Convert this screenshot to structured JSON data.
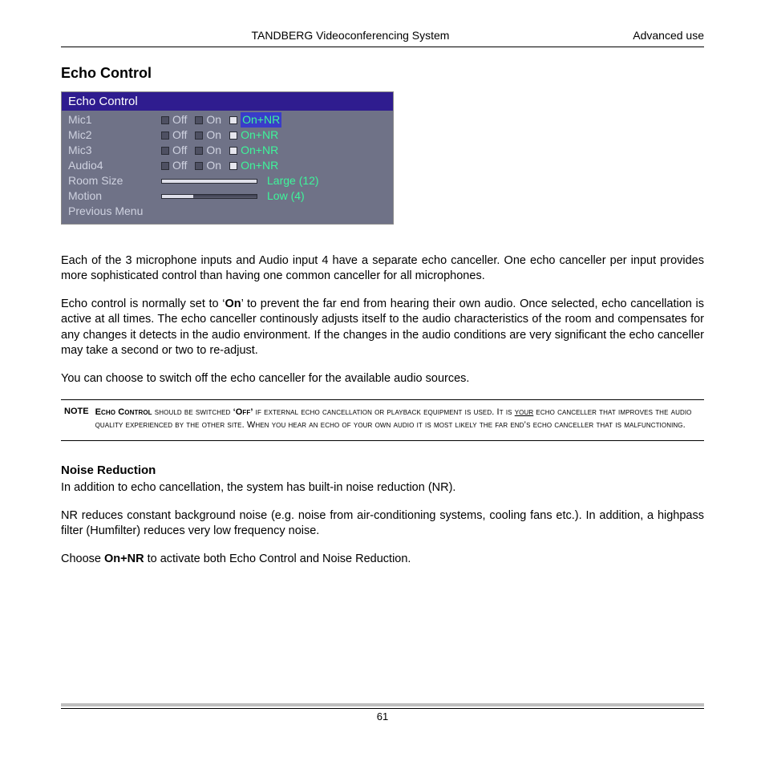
{
  "header": {
    "center": "TANDBERG Videoconferencing System",
    "right": "Advanced use"
  },
  "section": {
    "title": "Echo Control"
  },
  "osd": {
    "title": "Echo Control",
    "rows": [
      {
        "label": "Mic1",
        "options": [
          "Off",
          "On",
          "On+NR"
        ],
        "selected": 2,
        "highlight": true
      },
      {
        "label": "Mic2",
        "options": [
          "Off",
          "On",
          "On+NR"
        ],
        "selected": 2,
        "highlight": false
      },
      {
        "label": "Mic3",
        "options": [
          "Off",
          "On",
          "On+NR"
        ],
        "selected": 2,
        "highlight": false
      },
      {
        "label": "Audio4",
        "options": [
          "Off",
          "On",
          "On+NR"
        ],
        "selected": 2,
        "highlight": false
      }
    ],
    "sliders": [
      {
        "label": "Room Size",
        "fill_pct": 100,
        "track_width": 120,
        "value_text": "Large (12)"
      },
      {
        "label": "Motion",
        "fill_pct": 33,
        "track_width": 120,
        "value_text": "Low (4)"
      }
    ],
    "trailing": {
      "label": "Previous Menu"
    }
  },
  "paragraphs": {
    "p1": "Each of the 3 microphone inputs and Audio input 4 have a separate echo canceller. One echo canceller per input provides more sophisticated control than having one common canceller for all microphones.",
    "p2_pre": "Echo control is normally set to ‘",
    "p2_bold": "On",
    "p2_post": "’ to prevent the far end from hearing their own audio. Once selected, echo cancellation is active at all times. The echo canceller continously adjusts itself to the audio characteristics of the room and compensates for any changes it detects in the audio environment. If the changes in the audio conditions are very significant the echo canceller may take a second or two to re-adjust.",
    "p3": "You can choose to switch off the echo canceller for the available audio sources."
  },
  "note": {
    "lead": "NOTE",
    "ec": "Echo Control",
    "mid1": " should be switched ",
    "off": "‘Off’",
    "mid2": " if external echo cancellation or playback equipment is used. It is ",
    "your": "your",
    "mid3": " echo canceller that improves the audio quality experienced by the other site. When you hear an echo of your own audio it is most likely the far end’s echo canceller that is malfunctioning."
  },
  "noise": {
    "title": "Noise Reduction",
    "p1": "In addition to echo cancellation, the system has built-in noise reduction (NR).",
    "p2": "NR reduces constant background noise (e.g. noise from air-conditioning systems, cooling fans etc.). In addition, a highpass filter (Humfilter) reduces very low frequency noise.",
    "p3_pre": "Choose ",
    "p3_bold": "On+NR",
    "p3_post": " to activate both Echo Control and Noise Reduction."
  },
  "footer": {
    "page": "61"
  }
}
